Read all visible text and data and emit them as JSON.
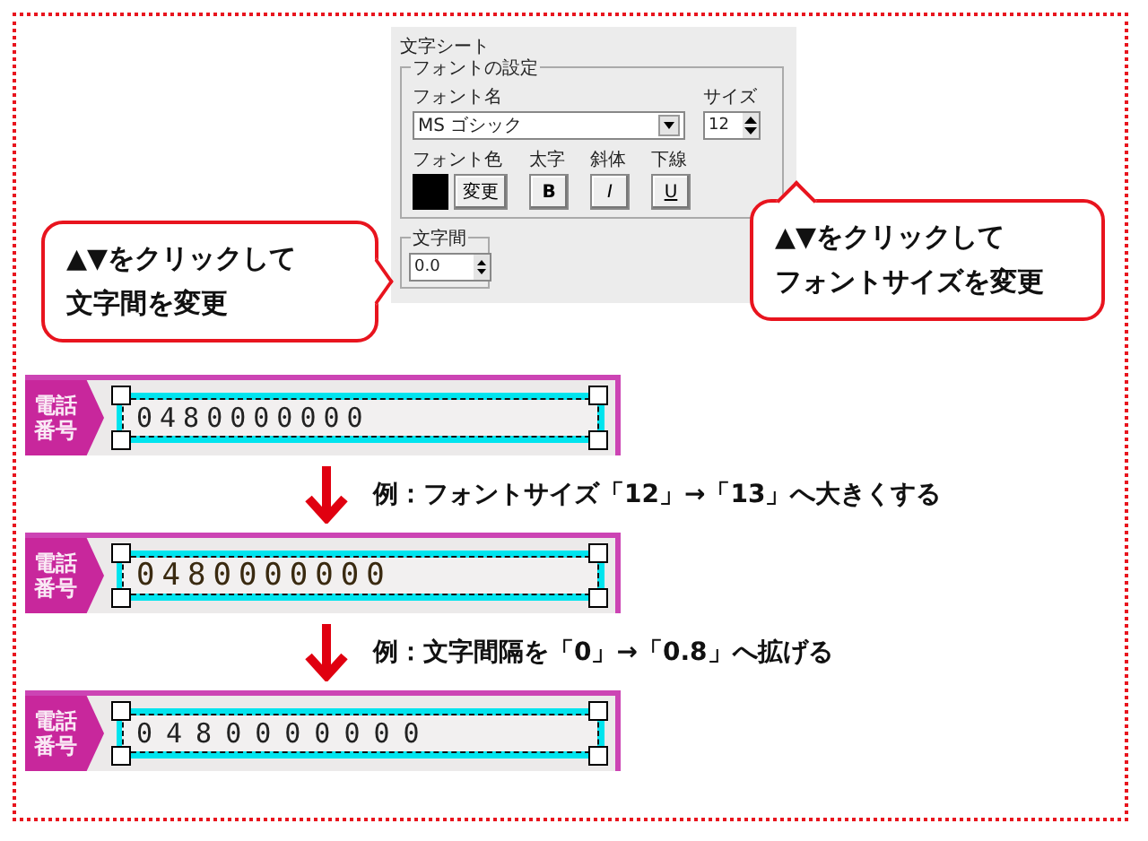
{
  "panel": {
    "title": "文字シート",
    "font_group": {
      "legend": "フォントの設定",
      "font_name_label": "フォント名",
      "font_name": "MS ゴシック",
      "size_label": "サイズ",
      "size": "12",
      "color_label": "フォント色",
      "color_button": "変更",
      "bold_label": "太字",
      "bold_button": "B",
      "italic_label": "斜体",
      "italic_button": "I",
      "underline_label": "下線",
      "underline_button": "U"
    },
    "spacing_group": {
      "legend": "文字間",
      "value": "0.0"
    }
  },
  "callouts": [
    {
      "lines": [
        "▲▼をクリックして",
        "文字間を変更"
      ]
    },
    {
      "lines": [
        "▲▼をクリックして",
        "フォントサイズを変更"
      ]
    }
  ],
  "steps": [
    {
      "kind": "original",
      "label_lines": [
        "電話",
        "番号"
      ],
      "number": "0480000000"
    },
    {
      "kind": "larger",
      "caption": "例：フォントサイズ「12」→「13」へ大きくする",
      "label_lines": [
        "電話",
        "番号"
      ],
      "number": "0480000000"
    },
    {
      "kind": "spaced",
      "caption": "例：文字間隔を「0」→「0.8」へ拡げる",
      "label_lines": [
        "電話",
        "番号"
      ],
      "number": "0480000000"
    }
  ]
}
